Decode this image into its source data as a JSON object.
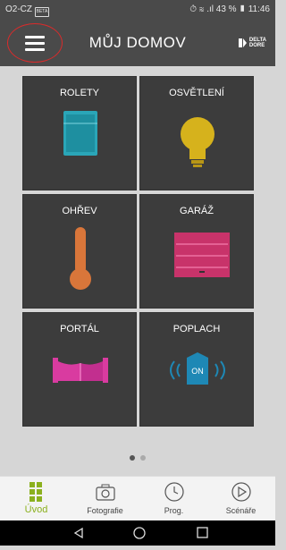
{
  "status": {
    "carrier": "O2-CZ",
    "carrier_icon": "BETA",
    "right": "⏱ ≋ .ıl 43 % ▮ 11:46"
  },
  "header": {
    "title": "MŮJ DOMOV",
    "logo_line1": "DELTA",
    "logo_line2": "DORE"
  },
  "tiles": [
    {
      "label": "ROLETY",
      "icon": "shutter-icon",
      "color": "#2aa6b8"
    },
    {
      "label": "OSVĚTLENÍ",
      "icon": "lightbulb-icon",
      "color": "#d6b21c"
    },
    {
      "label": "OHŘEV",
      "icon": "thermometer-icon",
      "color": "#d9763a"
    },
    {
      "label": "GARÁŽ",
      "icon": "garage-door-icon",
      "color": "#c8336a"
    },
    {
      "label": "PORTÁL",
      "icon": "gate-icon",
      "color": "#d93ba0"
    },
    {
      "label": "POPLACH",
      "icon": "alarm-icon",
      "color": "#1e88b5",
      "icon_text": "ON"
    }
  ],
  "pager": {
    "pages": 2,
    "current": 1
  },
  "nav": [
    {
      "label": "Úvod",
      "icon": "home-grid-icon",
      "active": true
    },
    {
      "label": "Fotografie",
      "icon": "camera-icon",
      "active": false
    },
    {
      "label": "Prog.",
      "icon": "clock-icon",
      "active": false
    },
    {
      "label": "Scénáře",
      "icon": "play-icon",
      "active": false
    }
  ],
  "colors": {
    "accent": "#8bb01e",
    "tile_bg": "#3c3c3c",
    "header_bg": "#4a4a4a"
  }
}
